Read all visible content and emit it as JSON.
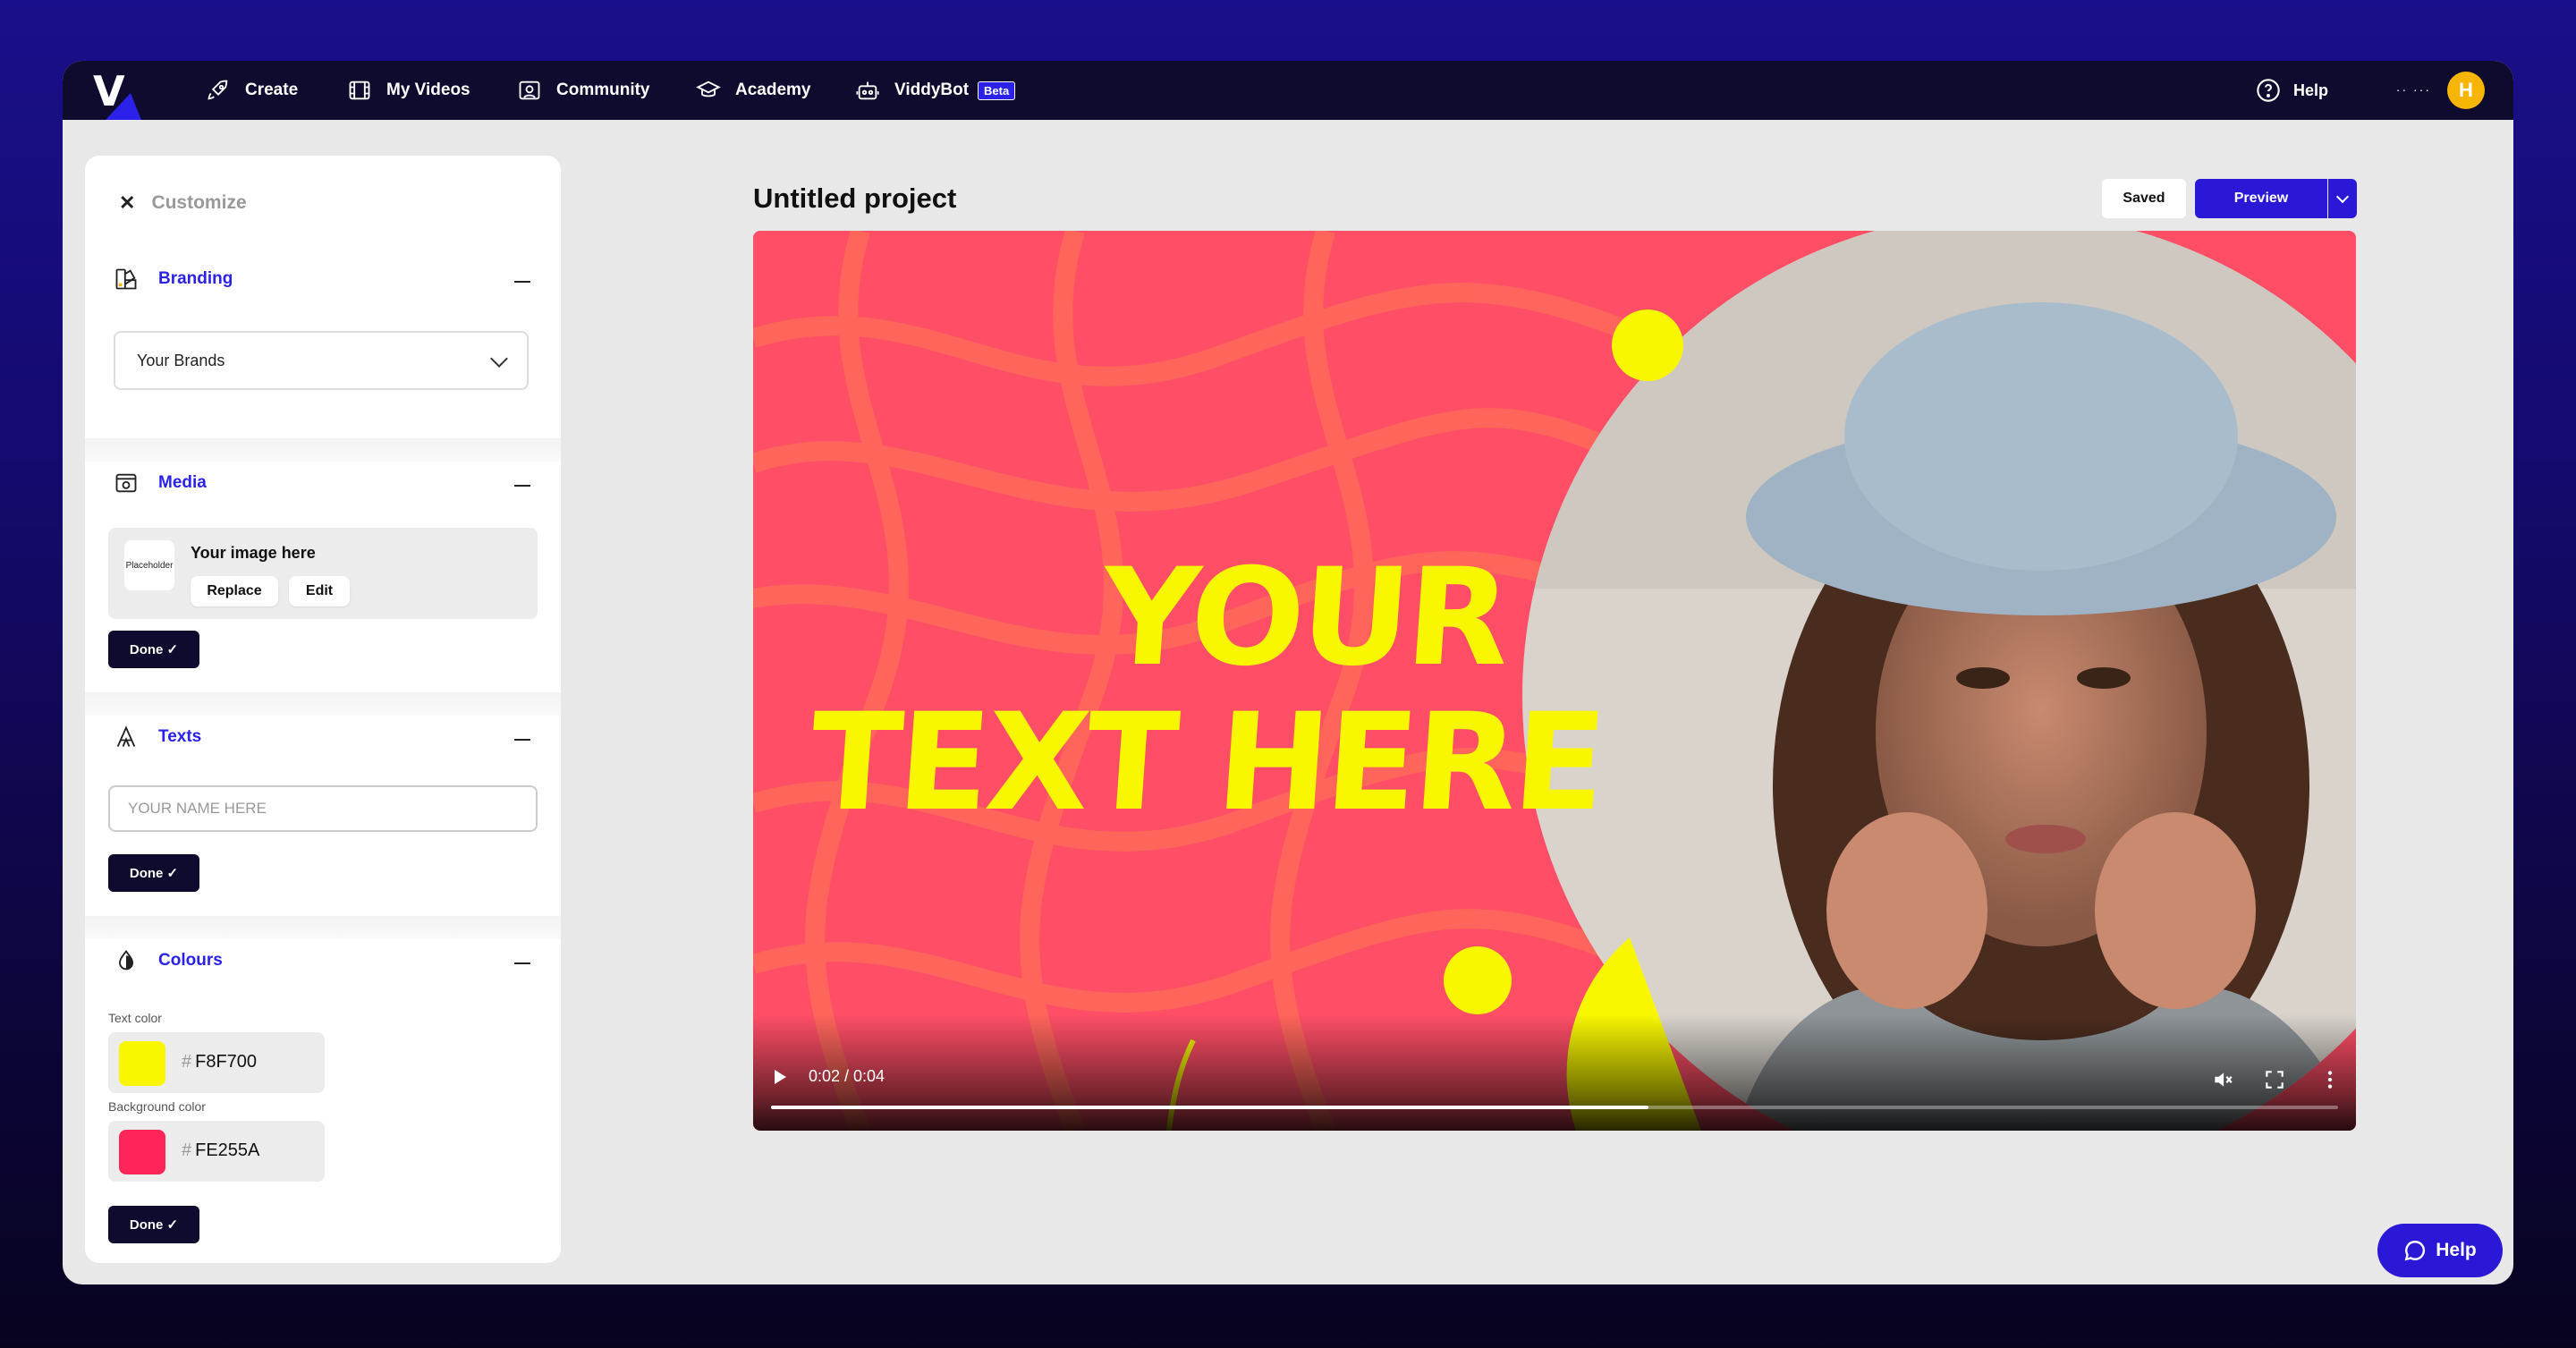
{
  "nav": {
    "logo_letter": "V",
    "items": [
      {
        "label": "Create",
        "icon": "rocket-icon"
      },
      {
        "label": "My Videos",
        "icon": "film-icon"
      },
      {
        "label": "Community",
        "icon": "community-icon"
      },
      {
        "label": "Academy",
        "icon": "graduation-cap-icon"
      },
      {
        "label": "ViddyBot",
        "icon": "robot-icon",
        "badge": "Beta"
      }
    ],
    "help_label": "Help",
    "dots": "·· ···",
    "avatar_initial": "H"
  },
  "sidebar": {
    "title": "Customize",
    "branding": {
      "title": "Branding",
      "select_value": "Your Brands"
    },
    "media": {
      "title": "Media",
      "thumb_text": "Placeholder",
      "item_title": "Your image here",
      "replace_label": "Replace",
      "edit_label": "Edit",
      "done_label": "Done ✓"
    },
    "texts": {
      "title": "Texts",
      "input_placeholder": "YOUR NAME HERE",
      "done_label": "Done ✓"
    },
    "colours": {
      "title": "Colours",
      "text_color_label": "Text color",
      "text_color_hex": "F8F700",
      "text_color": "#F8F700",
      "bg_color_label": "Background color",
      "bg_color_hex": "FE255A",
      "bg_color": "#FE255A",
      "hash": "#",
      "done_label": "Done ✓"
    }
  },
  "main": {
    "project_title": "Untitled project",
    "saved_label": "Saved",
    "preview_label": "Preview",
    "video": {
      "line1": "YOUR",
      "line2": "TEXT HERE",
      "time": "0:02 / 0:04",
      "progress": 0.56
    }
  },
  "help_fab": {
    "label": "Help"
  },
  "colors": {
    "accent": "#2B18D6",
    "nav_bg": "#0E0B2E",
    "video_bg": "#FF4E66",
    "yellow": "#F8F700",
    "avatar": "#F6B500"
  }
}
